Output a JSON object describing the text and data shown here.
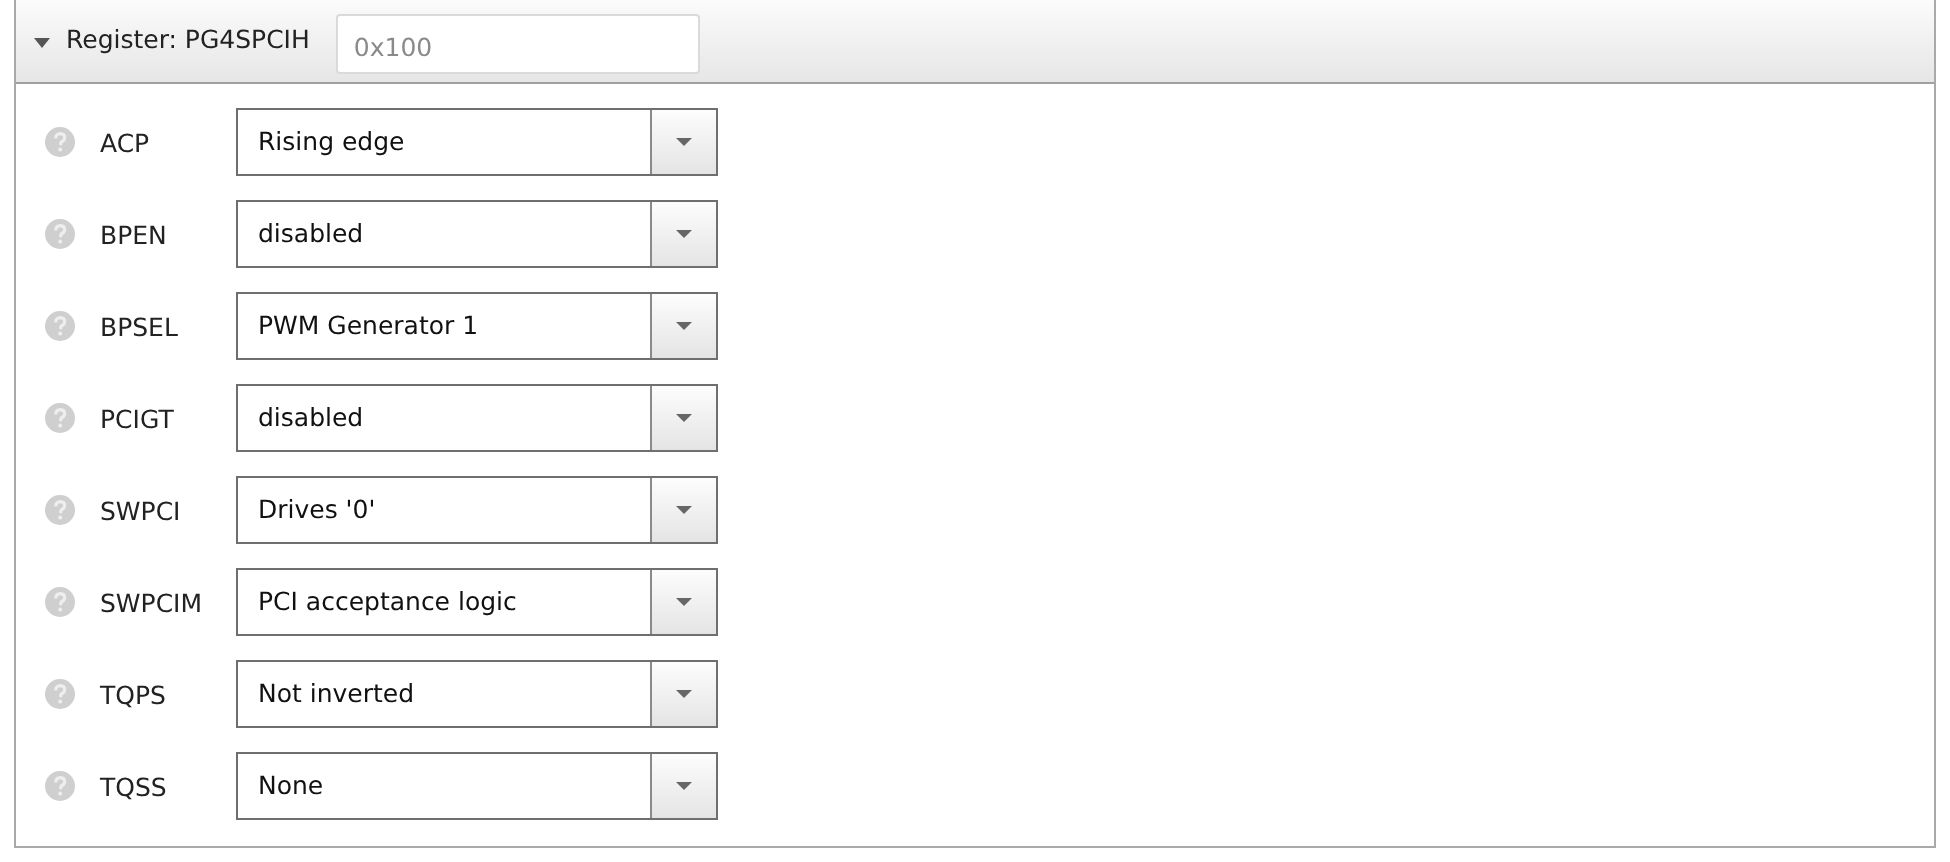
{
  "header": {
    "expanded": true,
    "title": "Register: PG4SPCIH",
    "address": {
      "value": "0x100"
    }
  },
  "fields": [
    {
      "label": "ACP",
      "value": "Rising edge"
    },
    {
      "label": "BPEN",
      "value": "disabled"
    },
    {
      "label": "BPSEL",
      "value": "PWM Generator 1"
    },
    {
      "label": "PCIGT",
      "value": "disabled"
    },
    {
      "label": "SWPCI",
      "value": "Drives '0'"
    },
    {
      "label": "SWPCIM",
      "value": "PCI acceptance logic"
    },
    {
      "label": "TQPS",
      "value": "Not inverted"
    },
    {
      "label": "TQSS",
      "value": "None"
    }
  ]
}
